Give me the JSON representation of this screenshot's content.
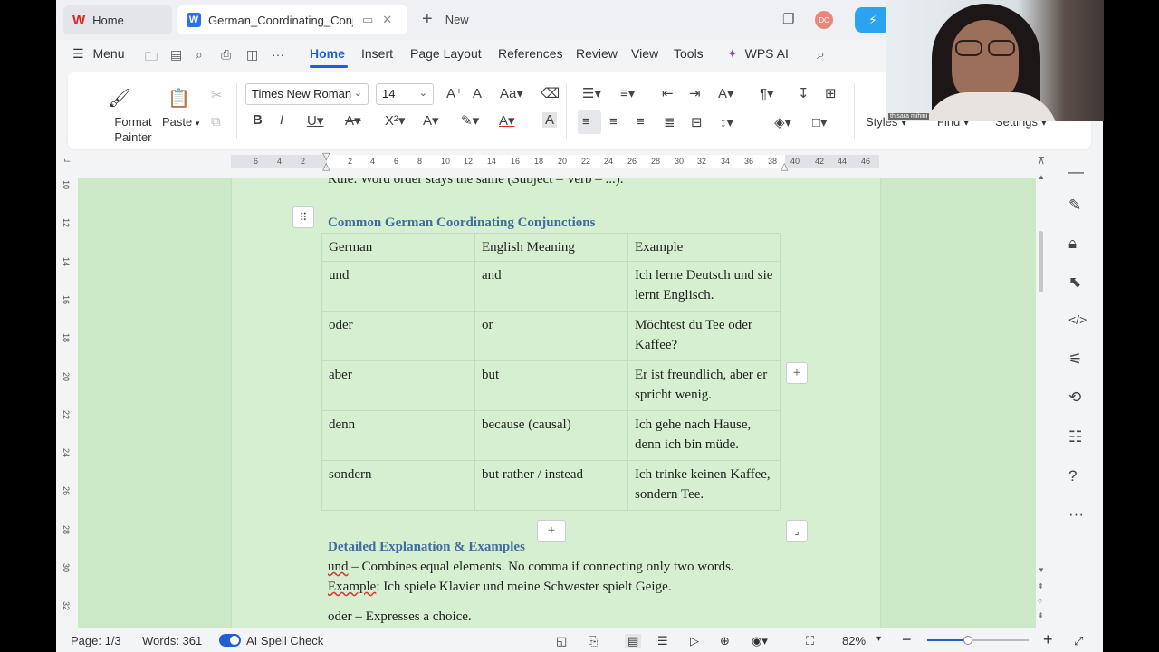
{
  "tabs": {
    "home_label": "Home",
    "doc_title": "German_Coordinating_Conjunctions",
    "new_label": "New"
  },
  "user_badge": "DC",
  "menu": {
    "menu_label": "Menu",
    "items": [
      "Home",
      "Insert",
      "Page Layout",
      "References",
      "Review",
      "View",
      "Tools",
      "WPS AI"
    ]
  },
  "ribbon": {
    "format_painter": "Format Painter",
    "paste": "Paste",
    "font_name": "Times New Roman",
    "font_size": "14",
    "styles": "Styles",
    "find": "Find",
    "settings": "Settings"
  },
  "ruler_numbers": [
    "6",
    "4",
    "2",
    "2",
    "4",
    "6",
    "8",
    "10",
    "12",
    "14",
    "16",
    "18",
    "20",
    "22",
    "24",
    "26",
    "28",
    "30",
    "32",
    "34",
    "36",
    "38",
    "40",
    "42",
    "44",
    "46"
  ],
  "vruler_numbers": [
    "10",
    "12",
    "14",
    "16",
    "18",
    "20",
    "22",
    "24",
    "26",
    "28",
    "30",
    "32"
  ],
  "document": {
    "previous_line": "Rule: Word order stays the same (Subject – Verb – ...).",
    "table_heading": "Common German Coordinating Conjunctions",
    "table": {
      "headers": [
        "German",
        "English Meaning",
        "Example"
      ],
      "rows": [
        [
          "und",
          "and",
          "Ich lerne Deutsch und sie lernt Englisch."
        ],
        [
          "oder",
          "or",
          "Möchtest du Tee oder Kaffee?"
        ],
        [
          "aber",
          "but",
          "Er ist freundlich, aber er spricht wenig."
        ],
        [
          "denn",
          "because (causal)",
          "Ich gehe nach Hause, denn ich bin müde."
        ],
        [
          "sondern",
          "but rather / instead",
          "Ich trinke keinen Kaffee, sondern Tee."
        ]
      ]
    },
    "section_heading": "Detailed Explanation & Examples",
    "und_word": "und",
    "und_rest": " – Combines equal elements. No comma if connecting only two words.",
    "example_word": "Example",
    "example_rest": ": Ich spiele Klavier und meine Schwester spielt Geige.",
    "oder_line": "oder – Expresses a choice."
  },
  "status": {
    "page": "Page: 1/3",
    "words": "Words: 361",
    "spell": "AI Spell Check",
    "zoom": "82%"
  },
  "webcam_name": "thisara mihini",
  "colors": {
    "accent": "#1f5fd1",
    "page_bg": "#d6efd1",
    "heading": "#3f6d9e"
  }
}
